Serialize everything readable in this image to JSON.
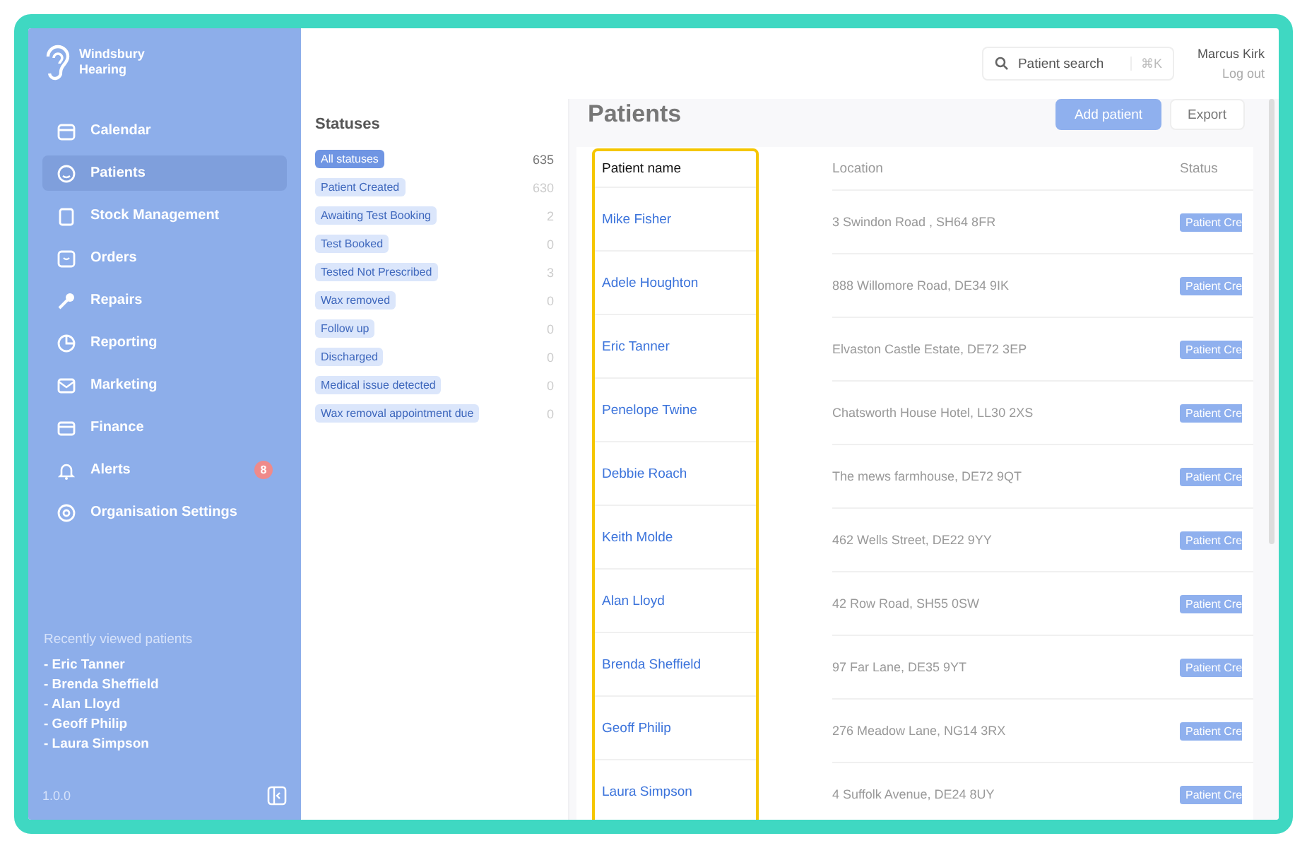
{
  "sidebar": {
    "logo": "Windsbury Hearing",
    "items": [
      {
        "label": "Calendar",
        "selected": false
      },
      {
        "label": "Patients",
        "selected": true
      },
      {
        "label": "Stock Management",
        "selected": false
      },
      {
        "label": "Orders",
        "selected": false
      },
      {
        "label": "Repairs",
        "selected": false
      },
      {
        "label": "Reporting",
        "selected": false
      },
      {
        "label": "Marketing",
        "selected": false
      },
      {
        "label": "Finance",
        "selected": false
      },
      {
        "label": "Alerts",
        "selected": false,
        "badge": "8"
      },
      {
        "label": "Organisation Settings",
        "selected": false
      }
    ],
    "recent": {
      "title": "Recently viewed patients",
      "bullet": "-",
      "items": [
        "Eric Tanner",
        "Brenda Sheffield",
        "Alan Lloyd",
        "Geoff Philip",
        "Laura Simpson"
      ]
    },
    "version": "1.0.0"
  },
  "statuses": {
    "title": "Statuses",
    "items": [
      {
        "label": "All statuses",
        "count": "635",
        "selected": true
      },
      {
        "label": "Patient Created",
        "count": "630",
        "selected": false
      },
      {
        "label": "Awaiting Test Booking",
        "count": "2",
        "selected": false
      },
      {
        "label": "Test Booked",
        "count": "0",
        "selected": false
      },
      {
        "label": "Tested Not Prescribed",
        "count": "3",
        "selected": false
      },
      {
        "label": "Wax removed",
        "count": "0",
        "selected": false
      },
      {
        "label": "Follow up",
        "count": "0",
        "selected": false
      },
      {
        "label": "Discharged",
        "count": "0",
        "selected": false
      },
      {
        "label": "Medical issue detected",
        "count": "0",
        "selected": false
      },
      {
        "label": "Wax removal appointment due",
        "count": "0",
        "selected": false
      }
    ]
  },
  "header": {
    "search": {
      "placeholder": "Patient search",
      "shortcut": "⌘K"
    },
    "user": "Marcus Kirk",
    "logout": "Log out"
  },
  "page": {
    "title": "Patients",
    "buttons": [
      "Add patient",
      "Export"
    ]
  },
  "table": {
    "columns": [
      "Patient name",
      "Location",
      "Status"
    ],
    "rows": [
      [
        "Mike Fisher",
        "3 Swindon Road , SH64 8FR",
        "Patient Cre"
      ],
      [
        "Adele Houghton",
        "888 Willomore Road, DE34 9IK",
        "Patient Cre"
      ],
      [
        "Eric Tanner",
        "Elvaston Castle Estate, DE72 3EP",
        "Patient Cre"
      ],
      [
        "Penelope Twine",
        "Chatsworth House Hotel, LL30 2XS",
        "Patient Cre"
      ],
      [
        "Debbie Roach",
        "The mews farmhouse, DE72 9QT",
        "Patient Cre"
      ],
      [
        "Keith Molde",
        "462 Wells Street, DE22 9YY",
        "Patient Cre"
      ],
      [
        "Alan Lloyd",
        "42 Row Road, SH55 0SW",
        "Patient Cre"
      ],
      [
        "Brenda Sheffield",
        "97 Far Lane, DE35 9YT",
        "Patient Cre"
      ],
      [
        "Geoff Philip",
        "276 Meadow Lane, NG14 3RX",
        "Patient Cre"
      ],
      [
        "Laura Simpson",
        "4 Suffolk Avenue, DE24 8UY",
        "Patient Cre"
      ]
    ]
  }
}
